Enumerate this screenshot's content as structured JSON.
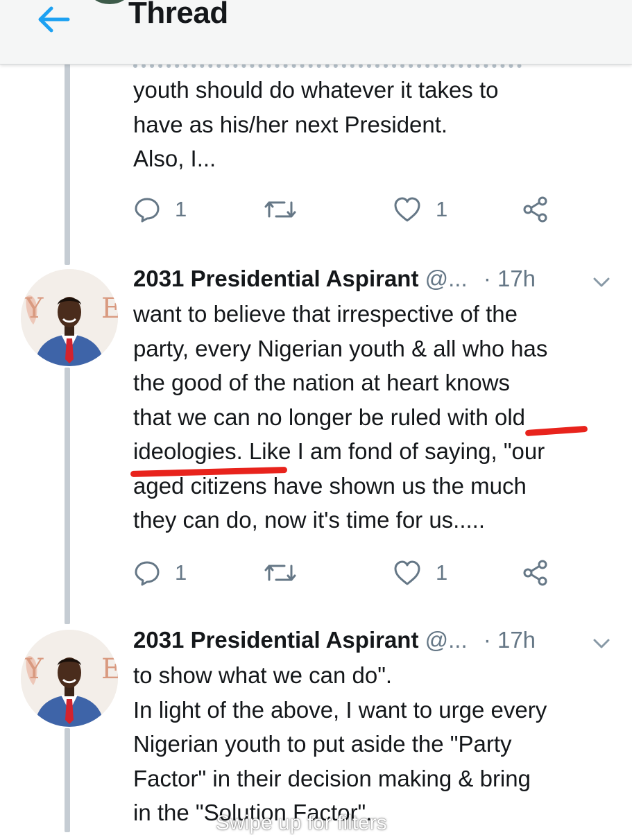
{
  "header": {
    "title": "Thread",
    "back_icon": "arrow-left-icon",
    "accent_color": "#1da1f2"
  },
  "tweets": [
    {
      "text": "youth should do whatever it takes to\nhave as his/her next President.\nAlso, I...",
      "actions": {
        "reply_count": "1",
        "retweet_count": "",
        "like_count": "1"
      }
    },
    {
      "author": "2031 Presidential Aspirant",
      "handle": "@...",
      "time": "· 17h",
      "text": "want to believe that irrespective of the\nparty, every Nigerian youth & all who has\nthe good of the nation at heart knows\nthat we can no longer be ruled with old\nideologies. Like I am fond of saying, \"our\naged citizens have shown us the much\nthey can do, now it's time for us.....",
      "actions": {
        "reply_count": "1",
        "retweet_count": "",
        "like_count": "1"
      }
    },
    {
      "author": "2031 Presidential Aspirant",
      "handle": "@...",
      "time": "· 17h",
      "text": "to show what we can do\".\nIn light of the above, I want to urge every\nNigerian youth to put aside the \"Party\nFactor\" in their decision making & bring\nin the \"Solution Factor\"."
    }
  ],
  "overlay": {
    "swipe_hint": "Swipe up for filters"
  },
  "colors": {
    "action_gray": "#657786",
    "thread_line": "#c5ccd3",
    "highlight_red": "#e8231c"
  }
}
